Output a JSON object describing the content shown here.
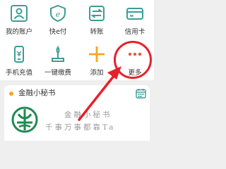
{
  "grid": {
    "row1": [
      {
        "label": "我的账户",
        "icon": "account-icon"
      },
      {
        "label": "快e付",
        "icon": "epay-icon"
      },
      {
        "label": "转账",
        "icon": "transfer-icon"
      },
      {
        "label": "信用卡",
        "icon": "credit-card-icon"
      }
    ],
    "row2": [
      {
        "label": "手机充值",
        "icon": "phone-recharge-icon"
      },
      {
        "label": "一键缴费",
        "icon": "payment-icon"
      },
      {
        "label": "添加",
        "icon": "plus-icon"
      },
      {
        "label": "更多",
        "icon": "more-dots-icon"
      }
    ]
  },
  "card": {
    "title": "金融小秘书",
    "handwriting_line1": "金融小秘书",
    "handwriting_line2": "千事万事都靠Ta",
    "icon": "calendar-icon"
  },
  "colors": {
    "icon_teal": "#3e9c96",
    "plus_orange": "#f5a623",
    "highlight_red": "#e8202a",
    "more_dots_red": "#e05e3a",
    "logo_green": "#1f8a4f"
  }
}
